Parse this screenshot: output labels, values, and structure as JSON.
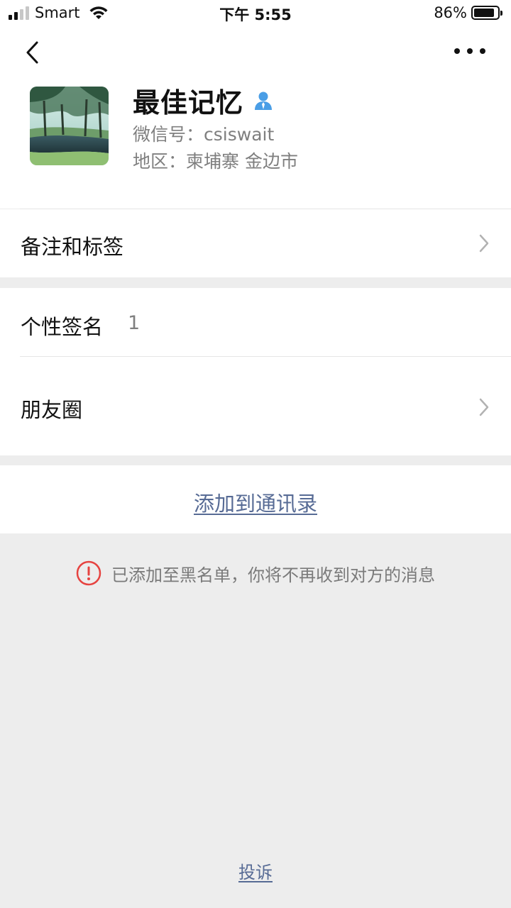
{
  "status_bar": {
    "carrier": "Smart",
    "time": "下午 5:55",
    "battery": "86%",
    "battery_level": 0.86
  },
  "nav": {
    "back_icon": "chevron-left-icon",
    "more_icon": "more-icon"
  },
  "profile": {
    "name": "最佳记忆",
    "wechat_id": "微信号：csiswait",
    "region": "地区：柬埔寨 金边市",
    "badge_icon": "person-icon",
    "badge_color": "#4a9ee6"
  },
  "rows": {
    "remarks_label": "备注和标签",
    "signature_label": "个性签名",
    "signature_value": "1",
    "moments_label": "朋友圈"
  },
  "actions": {
    "add_contact": "添加到通讯录",
    "complain": "投诉"
  },
  "notice": {
    "text": "已添加至黑名单，你将不再收到对方的消息",
    "icon": "warning-icon",
    "icon_color": "#e64340"
  },
  "colors": {
    "link": "#576b95",
    "background": "#ededed"
  }
}
